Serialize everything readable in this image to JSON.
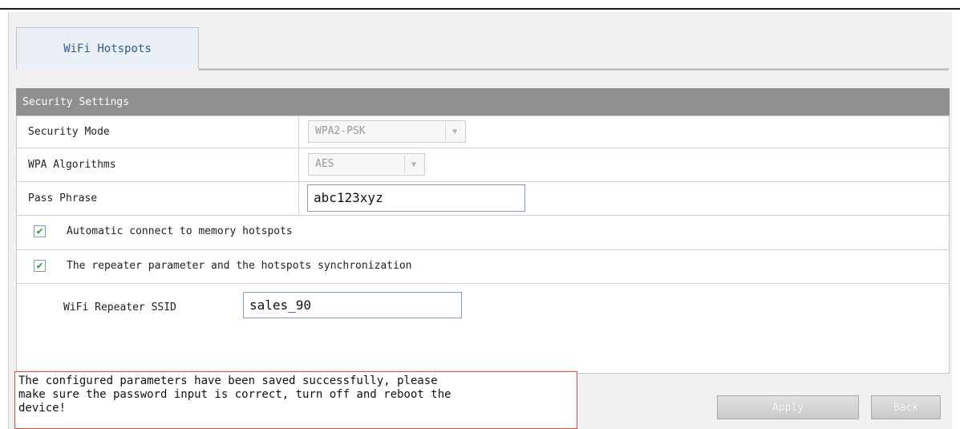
{
  "tabs": [
    {
      "label": "WiFi Hotspots"
    }
  ],
  "section": {
    "title": "Security Settings"
  },
  "form": {
    "security_mode": {
      "label": "Security Mode",
      "value": "WPA2-PSK"
    },
    "wpa_algorithms": {
      "label": "WPA Algorithms",
      "value": "AES"
    },
    "pass_phrase": {
      "label": "Pass Phrase",
      "value": "abc123xyz"
    },
    "auto_connect": {
      "label": "Automatic connect to memory hotspots",
      "checked": true
    },
    "repeater_sync": {
      "label": "The repeater parameter and the hotspots synchronization",
      "checked": true
    },
    "repeater_ssid": {
      "label": "WiFi Repeater SSID",
      "value": "sales_90"
    }
  },
  "status": {
    "line1": "The configured parameters have been saved successfully, please",
    "line2": "make sure the password input is correct, turn off and reboot the",
    "line3": "device!"
  },
  "buttons": {
    "apply": "Apply",
    "back": "Back"
  },
  "colors": {
    "header_bg": "#8f8f8f",
    "tab_text": "#2f5d91",
    "status_border": "#e14545",
    "check": "#21a121"
  }
}
